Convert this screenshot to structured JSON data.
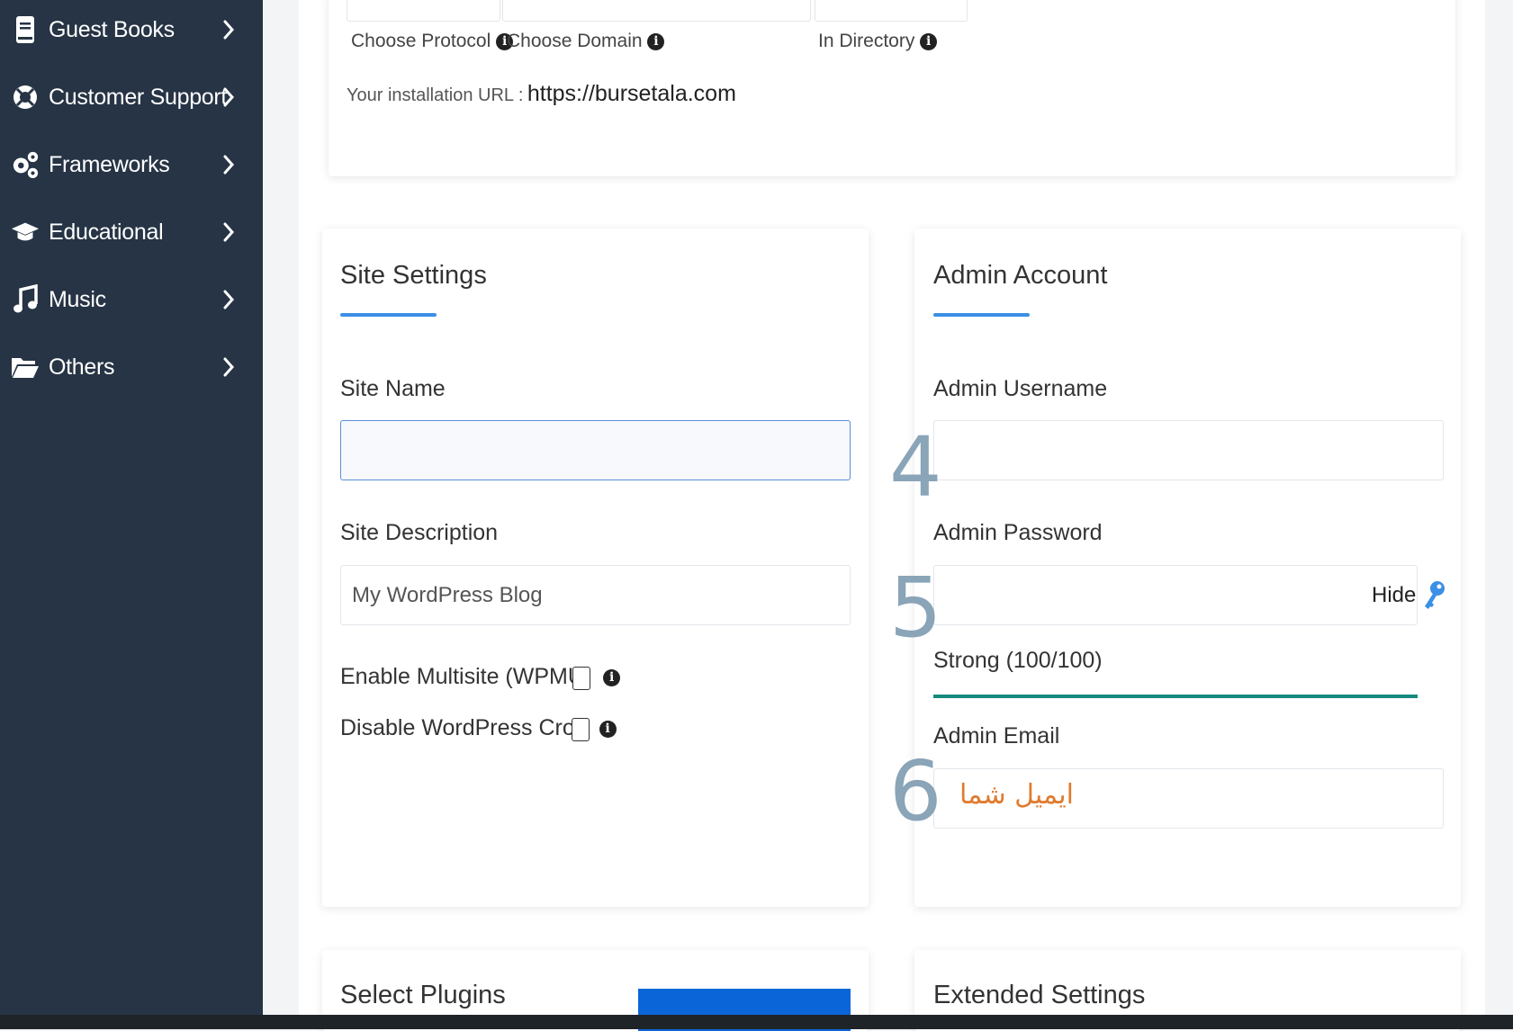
{
  "sidebar": {
    "items": [
      {
        "label": "Guest Books",
        "icon": "book-icon"
      },
      {
        "label": "Customer Support",
        "icon": "lifebuoy-icon"
      },
      {
        "label": "Frameworks",
        "icon": "gears-icon"
      },
      {
        "label": "Educational",
        "icon": "graduation-cap-icon"
      },
      {
        "label": "Music",
        "icon": "music-note-icon"
      },
      {
        "label": "Others",
        "icon": "folder-open-icon"
      }
    ]
  },
  "install": {
    "protocol_label": "Choose Protocol",
    "domain_label": "Choose Domain",
    "directory_label": "In Directory",
    "url_label": "Your installation URL :",
    "url_value": "https://bursetala.com"
  },
  "site_settings": {
    "title": "Site Settings",
    "site_name_label": "Site Name",
    "site_name_value": "",
    "site_description_label": "Site Description",
    "site_description_value": "My WordPress Blog",
    "multisite_label": "Enable Multisite (WPMU)",
    "cron_label": "Disable WordPress Cron"
  },
  "admin_account": {
    "title": "Admin Account",
    "username_label": "Admin Username",
    "username_value": "",
    "password_label": "Admin Password",
    "password_value": "",
    "hide_label": "Hide",
    "strength_text": "Strong (100/100)",
    "strength_fraction": 1.0,
    "email_label": "Admin Email",
    "email_annotation": "ایمیل شما"
  },
  "bottom": {
    "plugins_title": "Select Plugins",
    "extended_title": "Extended Settings"
  },
  "annotations": {
    "n4": "4",
    "n5": "5",
    "n6": "6"
  },
  "colors": {
    "sidebar_bg": "#263445",
    "accent_blue": "#3b8fe6",
    "strength_bar": "#168a7e",
    "annotation_orange": "#e07b2e",
    "primary_button": "#0a66d8"
  }
}
